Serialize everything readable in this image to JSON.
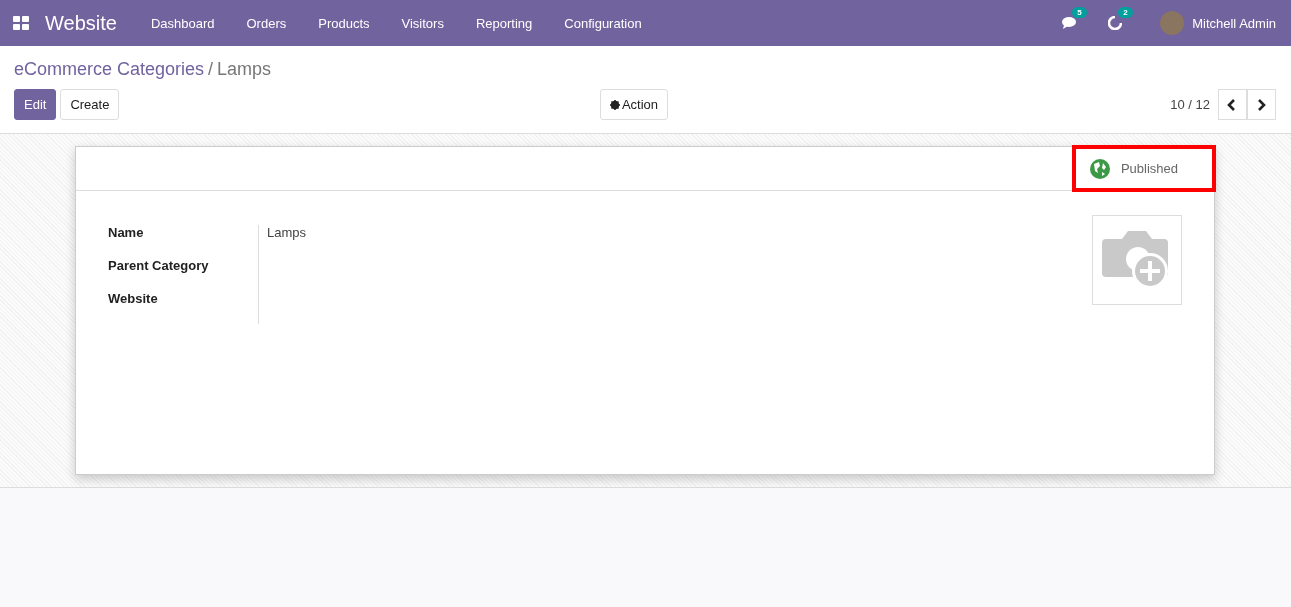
{
  "navbar": {
    "app_title": "Website",
    "menu": [
      {
        "label": "Dashboard"
      },
      {
        "label": "Orders"
      },
      {
        "label": "Products"
      },
      {
        "label": "Visitors"
      },
      {
        "label": "Reporting"
      },
      {
        "label": "Configuration"
      }
    ],
    "messages_count": "5",
    "activities_count": "2",
    "user": "Mitchell Admin"
  },
  "breadcrumb": {
    "parent": "eCommerce Categories",
    "separator": "/",
    "current": "Lamps"
  },
  "buttons": {
    "edit": "Edit",
    "create": "Create",
    "action": "Action"
  },
  "pager": {
    "value": "10 / 12"
  },
  "form": {
    "status": {
      "label": "Published",
      "published": true,
      "highlighted": true
    },
    "fields": [
      {
        "label": "Name",
        "value": "Lamps"
      },
      {
        "label": "Parent Category"
      },
      {
        "label": "Website"
      }
    ]
  }
}
